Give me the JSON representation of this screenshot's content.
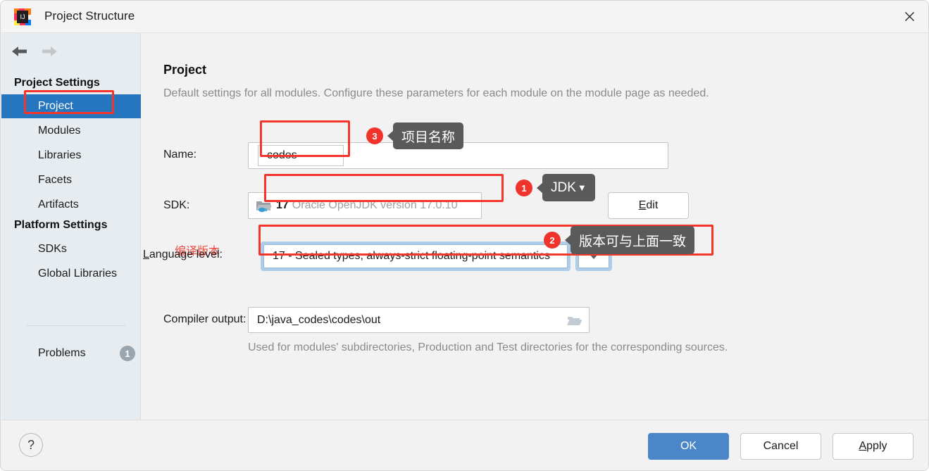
{
  "window": {
    "title": "Project Structure",
    "app_icon": "intellij-idea-icon",
    "close_icon": "close-icon"
  },
  "sidebar": {
    "nav": {
      "back_icon": "arrow-left-icon",
      "forward_icon": "arrow-right-icon"
    },
    "groups": [
      {
        "header": "Project Settings",
        "items": [
          {
            "label": "Project",
            "selected": true
          },
          {
            "label": "Modules",
            "selected": false
          },
          {
            "label": "Libraries",
            "selected": false
          },
          {
            "label": "Facets",
            "selected": false
          },
          {
            "label": "Artifacts",
            "selected": false
          }
        ]
      },
      {
        "header": "Platform Settings",
        "items": [
          {
            "label": "SDKs",
            "selected": false
          },
          {
            "label": "Global Libraries",
            "selected": false
          }
        ]
      }
    ],
    "problems": {
      "label": "Problems",
      "count": "1"
    }
  },
  "main": {
    "title": "Project",
    "description": "Default settings for all modules. Configure these parameters for each module on the module page as needed.",
    "name": {
      "label": "Name:",
      "value": "codes",
      "placeholder": ""
    },
    "sdk": {
      "label": "SDK:",
      "icon": "jdk-folder-icon",
      "version": "17",
      "description": "Oracle OpenJDK version 17.0.10",
      "edit_button": {
        "prefix": "",
        "mnemonic": "E",
        "rest": "dit"
      }
    },
    "language_level": {
      "label_mnemonic": "L",
      "label_rest": "anguage level:",
      "value": "17 - Sealed types, always-strict floating-point semantics",
      "dropdown_icon": "chevron-down-icon",
      "red_note": "编译版本"
    },
    "compiler_output": {
      "label": "Compiler output:",
      "value": "D:\\java_codes\\codes\\out",
      "browse_icon": "folder-open-icon",
      "hint": "Used for modules' subdirectories, Production and Test directories for the corresponding sources."
    }
  },
  "annotations": [
    {
      "number": "3",
      "tooltip": "项目名称",
      "caret": ""
    },
    {
      "number": "1",
      "tooltip": "JDK",
      "caret": "▼"
    },
    {
      "number": "2",
      "tooltip": "版本可与上面一致",
      "caret": ""
    }
  ],
  "footer": {
    "help_label": "?",
    "ok_label": "OK",
    "cancel_label": "Cancel",
    "apply": {
      "mnemonic": "A",
      "rest": "pply"
    }
  },
  "colors": {
    "accent_blue": "#2675bf",
    "annotation_red": "#f5342a",
    "ok_button": "#4a86c8",
    "tooltip_bg": "#5a5a5a"
  }
}
